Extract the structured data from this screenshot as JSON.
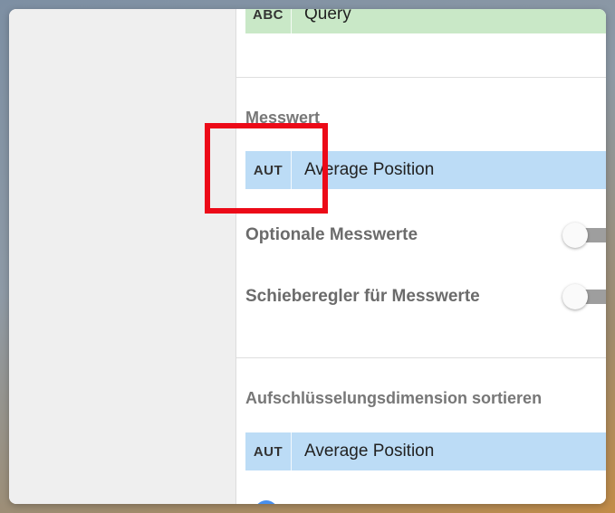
{
  "dimension": {
    "type_badge": "ABC",
    "label": "Query"
  },
  "metric_section": {
    "title": "Messwert",
    "chip": {
      "type_badge": "AUT",
      "label": "Average Position"
    },
    "optional_metrics_label": "Optionale Messwerte",
    "metric_slider_label": "Schieberegler für Messwerte"
  },
  "sort_section": {
    "title": "Aufschlüsselungsdimension sortieren",
    "chip": {
      "type_badge": "AUT",
      "label": "Average Position"
    }
  },
  "colors": {
    "dimension_chip": "#c9e8c7",
    "metric_chip": "#bcdcf6",
    "highlight": "#ec0a18"
  }
}
